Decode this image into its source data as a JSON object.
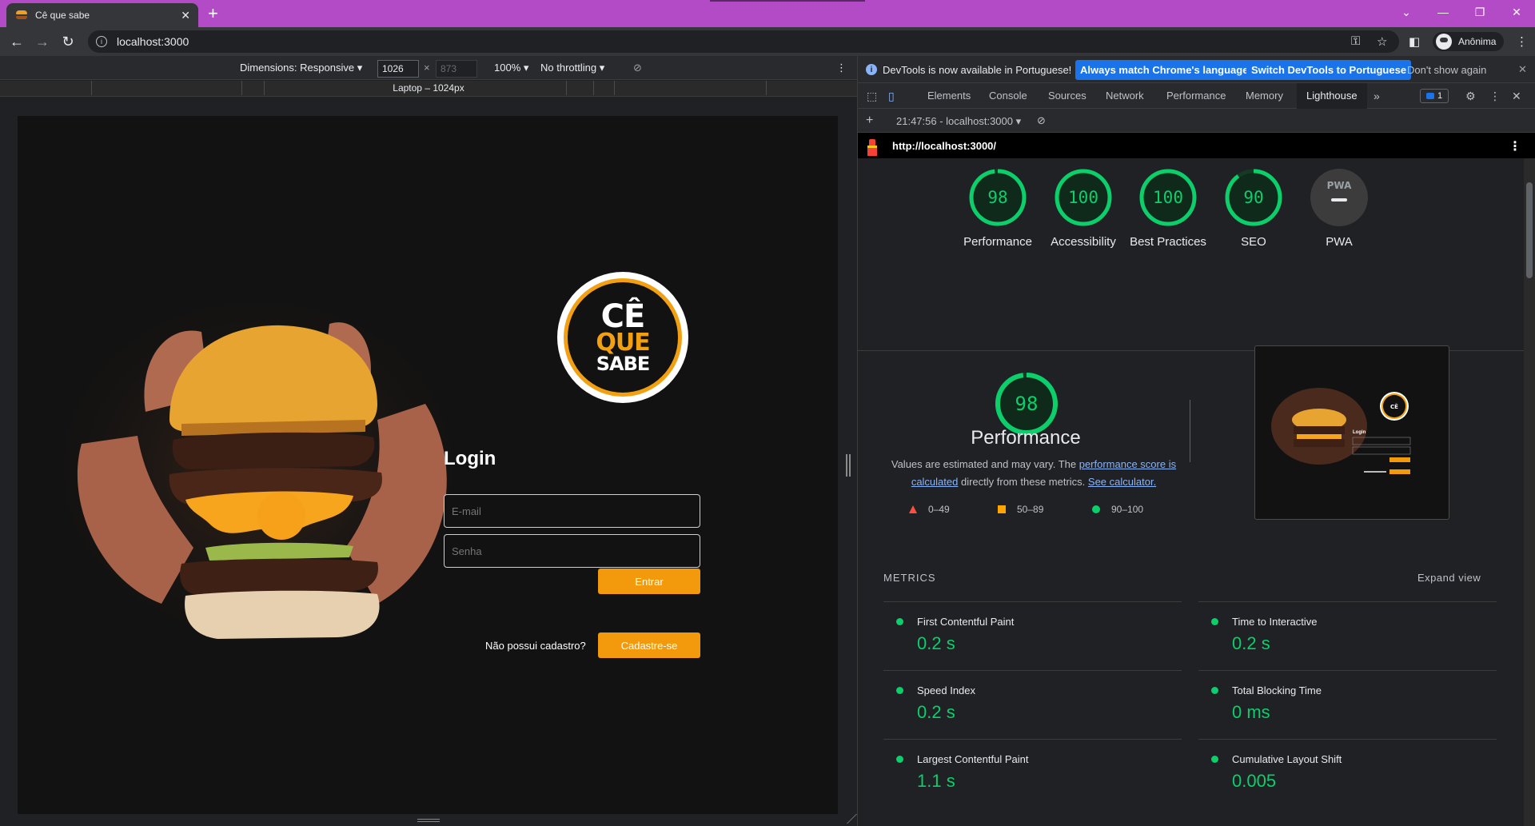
{
  "browser": {
    "tab_title": "Cê que sabe",
    "url": "localhost:3000",
    "profile_label": "Anônima"
  },
  "device_toolbar": {
    "dimensions_label": "Dimensions: Responsive",
    "width_value": "1026",
    "height_value": "873",
    "times": "×",
    "zoom": "100%",
    "throttling": "No throttling",
    "media_query_label": "Laptop – 1024px"
  },
  "page": {
    "logo_line1": "CÊ",
    "logo_line2": "QUE",
    "logo_line3": "SABE",
    "login_title": "Login",
    "email_placeholder": "E-mail",
    "password_placeholder": "Senha",
    "submit_label": "Entrar",
    "no_account_text": "Não possui cadastro?",
    "signup_label": "Cadastre-se"
  },
  "devtools": {
    "info_message": "DevTools is now available in Portuguese!",
    "btn_match_language": "Always match Chrome's language",
    "btn_switch": "Switch DevTools to Portuguese",
    "btn_dont_show": "Don't show again",
    "tabs": [
      "Elements",
      "Console",
      "Sources",
      "Network",
      "Performance",
      "Memory",
      "Lighthouse"
    ],
    "active_tab": "Lighthouse",
    "issues_count": "1",
    "report_selector": "21:47:56 - localhost:3000",
    "report_url": "http://localhost:3000/",
    "accent_green": "#0cce6b"
  },
  "lighthouse": {
    "gauges": [
      {
        "score": 98,
        "label": "Performance"
      },
      {
        "score": 100,
        "label": "Accessibility"
      },
      {
        "score": 100,
        "label": "Best Practices"
      },
      {
        "score": 90,
        "label": "SEO"
      },
      {
        "score": null,
        "label": "PWA",
        "badge": "PWA"
      }
    ],
    "perf_score": "98",
    "perf_title": "Performance",
    "perf_desc_prefix": "Values are estimated and may vary. The ",
    "perf_desc_link": "performance score is calculated",
    "perf_desc_middle": " directly from these metrics. ",
    "perf_desc_link2": "See calculator.",
    "legend": [
      {
        "range": "0–49",
        "shape": "triangle",
        "color": "#ff4e42"
      },
      {
        "range": "50–89",
        "shape": "square",
        "color": "#ffa400"
      },
      {
        "range": "90–100",
        "shape": "circle",
        "color": "#0cce6b"
      }
    ],
    "metrics_header": "METRICS",
    "expand_view": "Expand view",
    "metrics": [
      {
        "name": "First Contentful Paint",
        "value": "0.2 s"
      },
      {
        "name": "Time to Interactive",
        "value": "0.2 s"
      },
      {
        "name": "Speed Index",
        "value": "0.2 s"
      },
      {
        "name": "Total Blocking Time",
        "value": "0 ms"
      },
      {
        "name": "Largest Contentful Paint",
        "value": "1.1 s"
      },
      {
        "name": "Cumulative Layout Shift",
        "value": "0.005"
      }
    ],
    "thumb_login": "Login",
    "thumb_logo": "CÊ QUE SABE"
  }
}
